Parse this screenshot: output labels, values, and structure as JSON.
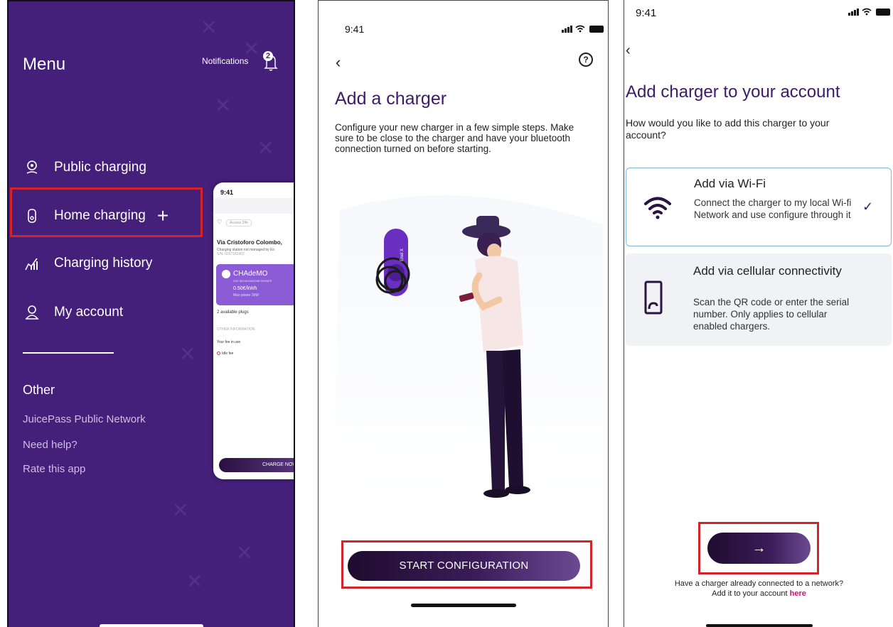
{
  "panel1": {
    "menu_title": "Menu",
    "notifications_label": "Notifications",
    "notifications_count": "2",
    "nav": [
      {
        "label": "Public charging",
        "icon": "location-pin-icon"
      },
      {
        "label": "Home charging",
        "icon": "home-charger-icon"
      },
      {
        "label": "Charging history",
        "icon": "chart-icon"
      },
      {
        "label": "My account",
        "icon": "user-icon"
      }
    ],
    "plus": "+",
    "other_title": "Other",
    "other_links": [
      "JuicePass Public Network",
      "Need help?",
      "Rate this app"
    ],
    "preview": {
      "time": "9:41",
      "tag": "Access 24h",
      "station_name": "Via Cristoforo Colombo,",
      "station_sub": "Charging station not managed by En",
      "serial": "S/N: 0297183402",
      "plug_type": "CHAdeMO",
      "plug_serial": "S/N: 8524510N0248FWIHNFE",
      "price": "0.50€/kWh",
      "max_power": "Max power 2kW",
      "available": "2 available plugs",
      "other_info": "OTHER INFORMATION",
      "fee_label": "Your fee in use",
      "idle_fee": "Idle fee",
      "charge_now": "CHARGE NOW"
    }
  },
  "panel2": {
    "time": "9:41",
    "back": "‹",
    "help": "?",
    "title": "Add a charger",
    "description": "Configure your new charger in a few simple steps. Make sure to be close to the charger and have your bluetooth connection turned on before starting.",
    "charger_label": "Enel X",
    "cta": "START CONFIGURATION"
  },
  "panel3": {
    "time": "9:41",
    "back": "‹",
    "title": "Add charger to your account",
    "question": "How would you like to add this charger to your account?",
    "options": [
      {
        "title": "Add via Wi-Fi",
        "desc": "Connect the charger to my local Wi-fi Network and use configure through it",
        "icon": "wifi-icon",
        "selected": true
      },
      {
        "title": "Add via cellular connectivity",
        "desc": "Scan the QR code or enter the serial number. Only applies to cellular enabled chargers.",
        "icon": "phone-icon",
        "selected": false
      }
    ],
    "check": "✓",
    "arrow": "→",
    "footer_line1": "Have a charger already connected to a network?",
    "footer_line2": "Add it to your account",
    "footer_link": "here"
  },
  "colors": {
    "brand_purple": "#45207a",
    "title_purple": "#3d1a6e",
    "highlight_red": "#d2242a",
    "link_pink": "#c2187a"
  }
}
